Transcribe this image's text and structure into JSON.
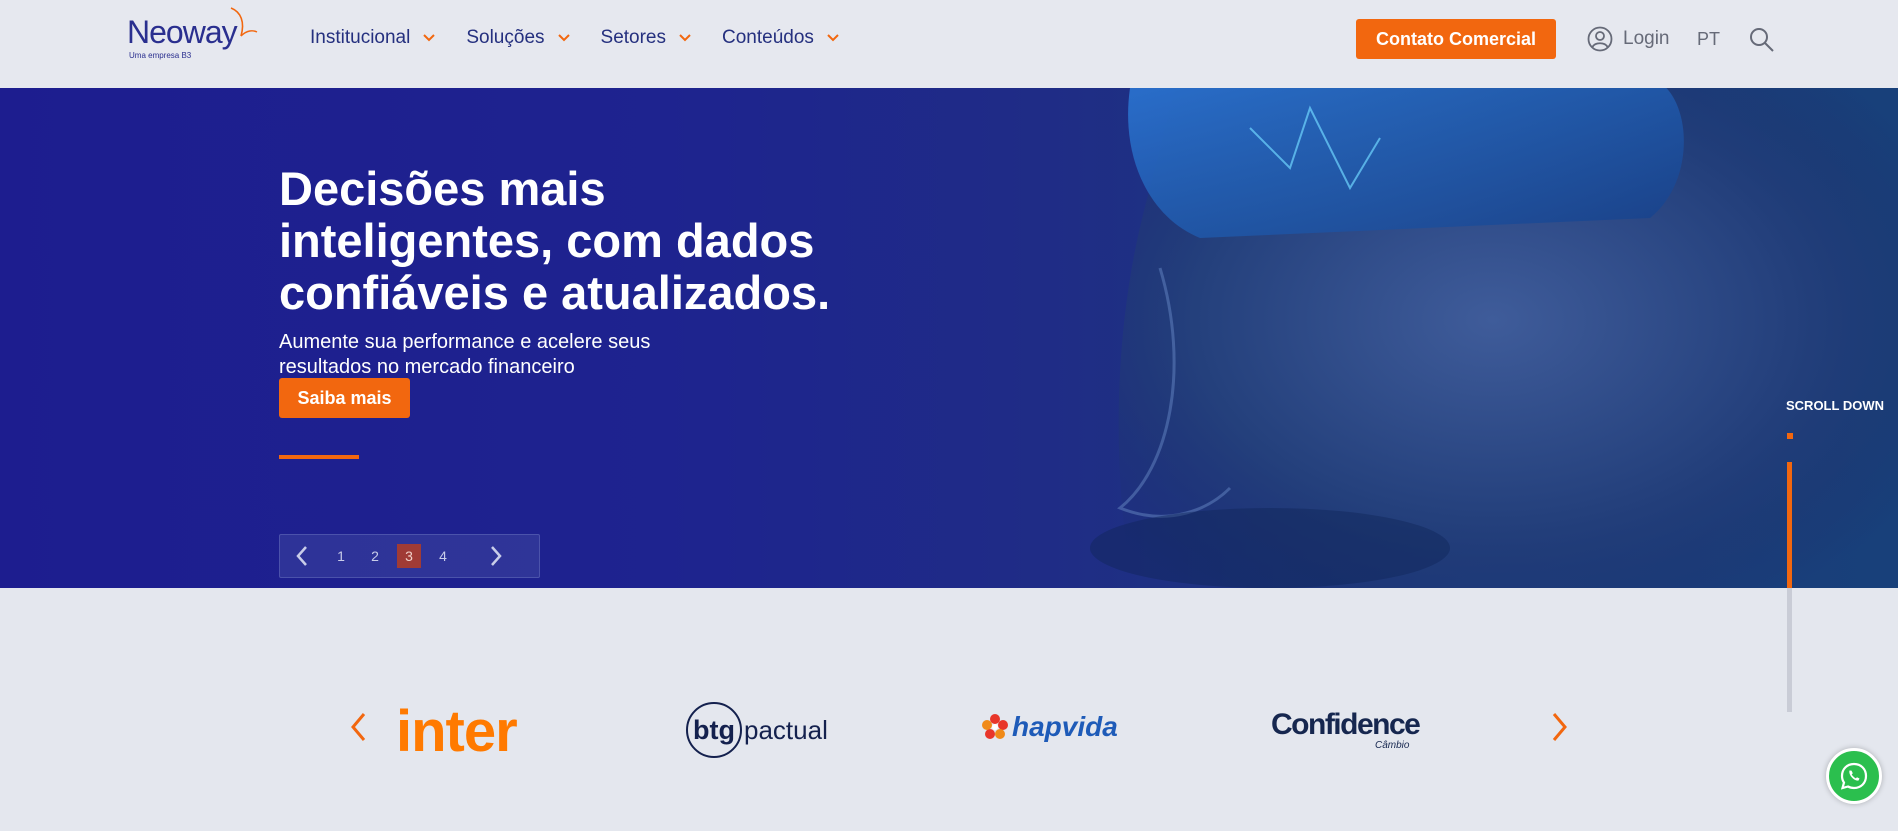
{
  "header": {
    "logo_text": "Neoway",
    "logo_subtitle": "Uma empresa B3",
    "nav": [
      {
        "label": "Institucional"
      },
      {
        "label": "Soluções"
      },
      {
        "label": "Setores"
      },
      {
        "label": "Conteúdos"
      }
    ],
    "cta_label": "Contato Comercial",
    "login_label": "Login",
    "language": "PT"
  },
  "hero": {
    "title": "Decisões mais inteligentes, com dados confiáveis e atualizados.",
    "subtitle": "Aumente sua performance e acelere seus resultados no mercado financeiro",
    "button_label": "Saiba mais",
    "pager": {
      "pages": [
        "1",
        "2",
        "3",
        "4"
      ],
      "active_page": "3"
    },
    "scroll_label": "SCROLL DOWN"
  },
  "partners": {
    "logos": [
      {
        "name": "inter"
      },
      {
        "name": "btg pactual",
        "mark": "btg",
        "text": "pactual"
      },
      {
        "name": "hapvida"
      },
      {
        "name": "Confidence",
        "sub": "Câmbio"
      }
    ]
  },
  "colors": {
    "accent": "#f2670f",
    "nav_text": "#25307f",
    "hero_bg": "#1d1d8f"
  },
  "icons": [
    "chevron-down-icon",
    "user-circle-icon",
    "search-icon",
    "chevron-left-icon",
    "chevron-right-icon",
    "whatsapp-icon"
  ]
}
